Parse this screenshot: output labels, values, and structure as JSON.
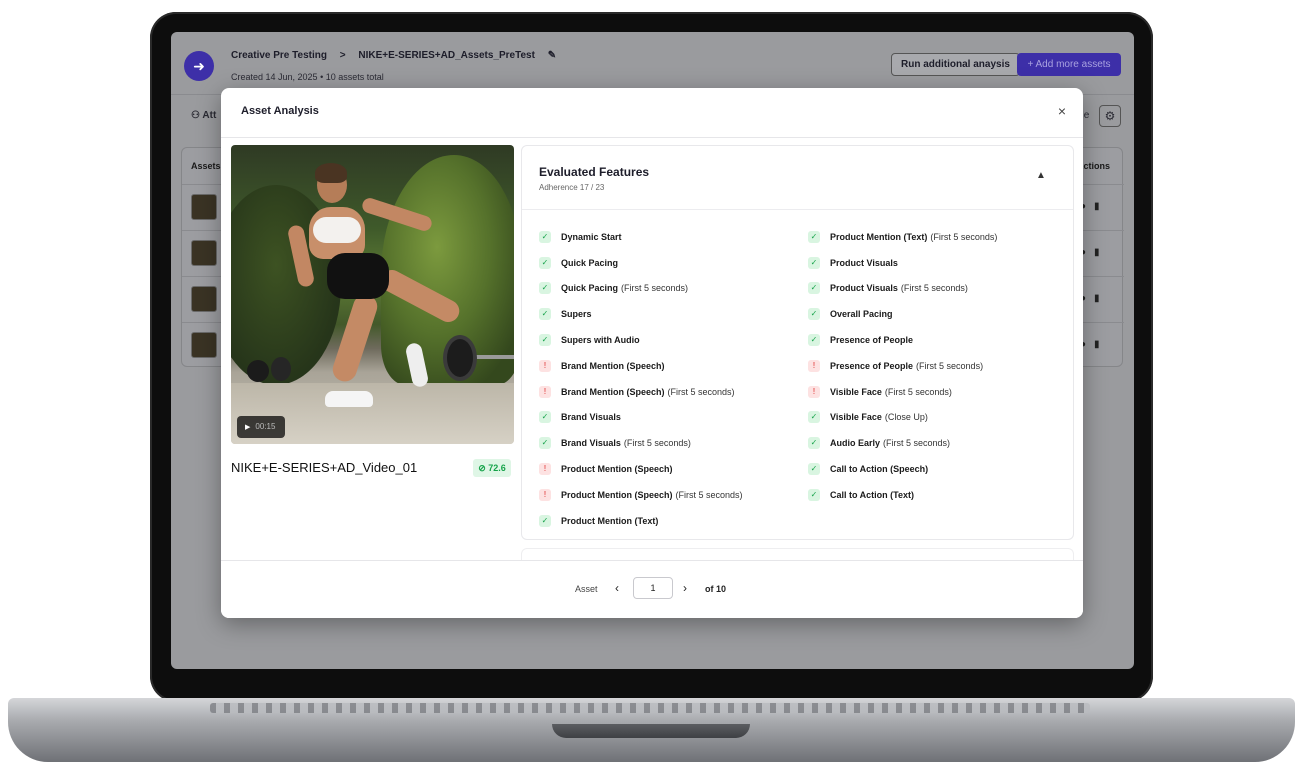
{
  "app": {
    "breadcrumb_root": "Creative Pre Testing",
    "breadcrumb_sep": ">",
    "breadcrumb_current": "NIKE+E-SERIES+AD_Assets_PreTest",
    "created_line": "Created 14 Jun, 2025 • 10 assets total",
    "run_button": "Run additional anaysis",
    "add_button": "+ Add more assets",
    "toolbar_left": "Att",
    "toolbar_right": "ble",
    "col_assets": "Assets",
    "col_actions": "Actions"
  },
  "modal": {
    "title": "Asset Analysis",
    "close_glyph": "×",
    "video": {
      "duration": "00:15",
      "asset_name": "NIKE+E-SERIES+AD_Video_01",
      "score": "72.6"
    },
    "features": {
      "title": "Evaluated Features",
      "adherence": "Adherence 17 / 23",
      "left": [
        {
          "name": "Dynamic Start",
          "qualifier": "",
          "status": "pass"
        },
        {
          "name": "Quick Pacing",
          "qualifier": "",
          "status": "pass"
        },
        {
          "name": "Quick Pacing",
          "qualifier": "(First 5 seconds)",
          "status": "pass"
        },
        {
          "name": "Supers",
          "qualifier": "",
          "status": "pass"
        },
        {
          "name": "Supers with Audio",
          "qualifier": "",
          "status": "pass"
        },
        {
          "name": "Brand Mention (Speech)",
          "qualifier": "",
          "status": "warn"
        },
        {
          "name": "Brand Mention (Speech)",
          "qualifier": "(First 5 seconds)",
          "status": "warn"
        },
        {
          "name": "Brand Visuals",
          "qualifier": "",
          "status": "pass"
        },
        {
          "name": "Brand Visuals",
          "qualifier": "(First 5 seconds)",
          "status": "pass"
        },
        {
          "name": "Product Mention (Speech)",
          "qualifier": "",
          "status": "warn"
        },
        {
          "name": "Product Mention (Speech)",
          "qualifier": "(First 5 seconds)",
          "status": "warn"
        },
        {
          "name": "Product Mention (Text)",
          "qualifier": "",
          "status": "pass"
        }
      ],
      "right": [
        {
          "name": "Product Mention (Text)",
          "qualifier": "(First 5 seconds)",
          "status": "pass"
        },
        {
          "name": "Product Visuals",
          "qualifier": "",
          "status": "pass"
        },
        {
          "name": "Product Visuals",
          "qualifier": "(First 5 seconds)",
          "status": "pass"
        },
        {
          "name": "Overall Pacing",
          "qualifier": "",
          "status": "pass"
        },
        {
          "name": "Presence of People",
          "qualifier": "",
          "status": "pass"
        },
        {
          "name": "Presence of People",
          "qualifier": "(First 5 seconds)",
          "status": "warn"
        },
        {
          "name": "Visible Face",
          "qualifier": "(First 5 seconds)",
          "status": "warn"
        },
        {
          "name": "Visible Face",
          "qualifier": "(Close Up)",
          "status": "pass"
        },
        {
          "name": "Audio Early",
          "qualifier": "(First 5 seconds)",
          "status": "pass"
        },
        {
          "name": "Call to Action (Speech)",
          "qualifier": "",
          "status": "pass"
        },
        {
          "name": "Call to Action (Text)",
          "qualifier": "",
          "status": "pass"
        }
      ]
    },
    "pager": {
      "label": "Asset",
      "prev_glyph": "‹",
      "next_glyph": "›",
      "current": "1",
      "total": "of 10"
    }
  },
  "colors": {
    "accent": "#3d2fa8",
    "pass": "#16a34a",
    "warn": "#dc2626"
  },
  "icons": {
    "pass": "check-circle-icon",
    "warn": "warning-triangle-icon"
  }
}
